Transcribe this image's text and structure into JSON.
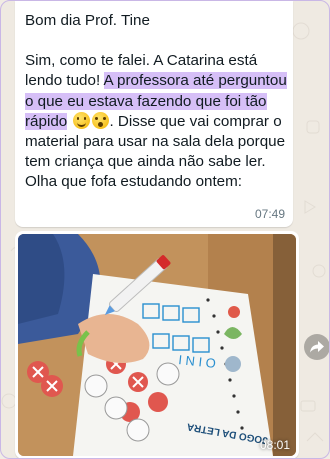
{
  "chat": {
    "message_1": {
      "greeting": "Bom dia Prof. Tine",
      "text_before": "Sim, como te falei. A Catarina está lendo tudo! ",
      "highlighted": "A professora até perguntou o que eu estava fazendo que foi tão rápido",
      "emoji_1": "smiling-face-icon",
      "emoji_2": "astonished-face-icon",
      "text_after": ". Disse que vai comprar o material para usar na sala dela porque tem criança que ainda não sabe ler. Olha que fofa estudando ontem:",
      "time": "07:49"
    },
    "message_2": {
      "type": "photo",
      "time": "08:01"
    },
    "highlight_color": "#d6bff7"
  }
}
